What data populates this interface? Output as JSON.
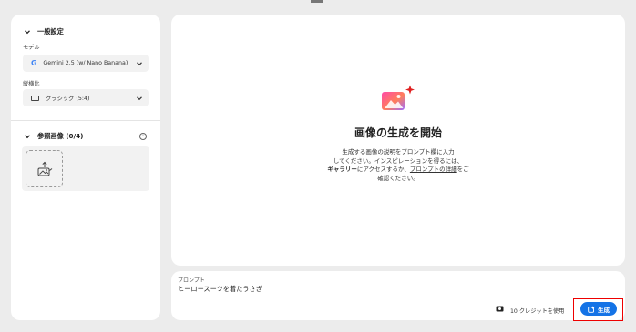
{
  "sidebar": {
    "general_section": "一般設定",
    "model_label": "モデル",
    "model_value": "Gemini 2.5 (w/ Nano Banana)",
    "model_logo": "G",
    "aspect_label": "縦横比",
    "aspect_value": "クラシック (5:4)",
    "reference_section": "参照画像 (0/4)",
    "info_glyph": "i"
  },
  "main": {
    "title": "画像の生成を開始",
    "desc_line1": "生成する画像の説明をプロンプト欄に入力",
    "desc_line2": "してください。インスピレーションを得るには、",
    "desc_gallery": "ギャラリー",
    "desc_mid": "にアクセスするか、",
    "desc_link": "プロンプトの詳細",
    "desc_after": "をご",
    "desc_line4": "確認ください。"
  },
  "prompt": {
    "label": "プロンプト",
    "value": "ヒーロースーツを着たうさぎ",
    "credits": "10 クレジットを使用",
    "generate_label": "生成"
  },
  "colors": {
    "accent": "#1473e6",
    "highlight": "#e00000",
    "background": "#ececec"
  },
  "icons": [
    "chevron-down-icon",
    "google-g-icon",
    "aspect-ratio-icon",
    "info-icon",
    "upload-image-icon",
    "image-sparkle-icon",
    "credit-icon",
    "generate-icon"
  ]
}
